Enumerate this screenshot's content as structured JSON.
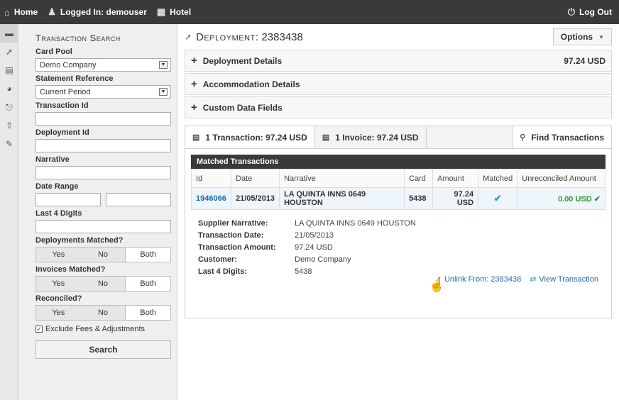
{
  "topbar": {
    "home": "Home",
    "user": "Logged In: demouser",
    "hotel": "Hotel",
    "logout": "Log Out"
  },
  "search": {
    "title": "Transaction Search",
    "card_pool_label": "Card Pool",
    "card_pool_value": "Demo Company",
    "statement_ref_label": "Statement Reference",
    "statement_ref_value": "Current Period",
    "transaction_id_label": "Transaction Id",
    "deployment_id_label": "Deployment Id",
    "narrative_label": "Narrative",
    "date_range_label": "Date Range",
    "last4_label": "Last 4 Digits",
    "deployments_matched_label": "Deployments Matched?",
    "invoices_matched_label": "Invoices Matched?",
    "reconciled_label": "Reconciled?",
    "opt_yes": "Yes",
    "opt_no": "No",
    "opt_both": "Both",
    "exclude_fees": "Exclude Fees & Adjustments",
    "search_button": "Search"
  },
  "main": {
    "title_prefix": "Deployment:",
    "title_id": "2383438",
    "options": "Options",
    "sections": [
      {
        "label": "Deployment Details",
        "amount": "97.24 USD"
      },
      {
        "label": "Accommodation Details",
        "amount": ""
      },
      {
        "label": "Custom Data Fields",
        "amount": ""
      }
    ],
    "tabs": {
      "transactions": "1 Transaction: 97.24 USD",
      "invoices": "1 Invoice: 97.24 USD",
      "find": "Find Transactions"
    },
    "matched": {
      "header": "Matched Transactions",
      "columns": [
        "Id",
        "Date",
        "Narrative",
        "Card",
        "Amount",
        "Matched",
        "Unreconciled Amount"
      ],
      "row": {
        "id": "1946066",
        "date": "21/05/2013",
        "narrative": "LA QUINTA INNS 0649 HOUSTON",
        "card": "5438",
        "amount": "97.24 USD",
        "unreconciled": "0.00 USD"
      }
    },
    "detail": {
      "supplier_narrative_k": "Supplier Narrative:",
      "supplier_narrative_v": "LA QUINTA INNS 0649 HOUSTON",
      "tx_date_k": "Transaction Date:",
      "tx_date_v": "21/05/2013",
      "tx_amount_k": "Transaction Amount:",
      "tx_amount_v": "97.24 USD",
      "customer_k": "Customer:",
      "customer_v": "Demo Company",
      "last4_k": "Last 4 Digits:",
      "last4_v": "5438",
      "unlink": "Unlink From: 2383438",
      "view": "View Transaction"
    }
  }
}
